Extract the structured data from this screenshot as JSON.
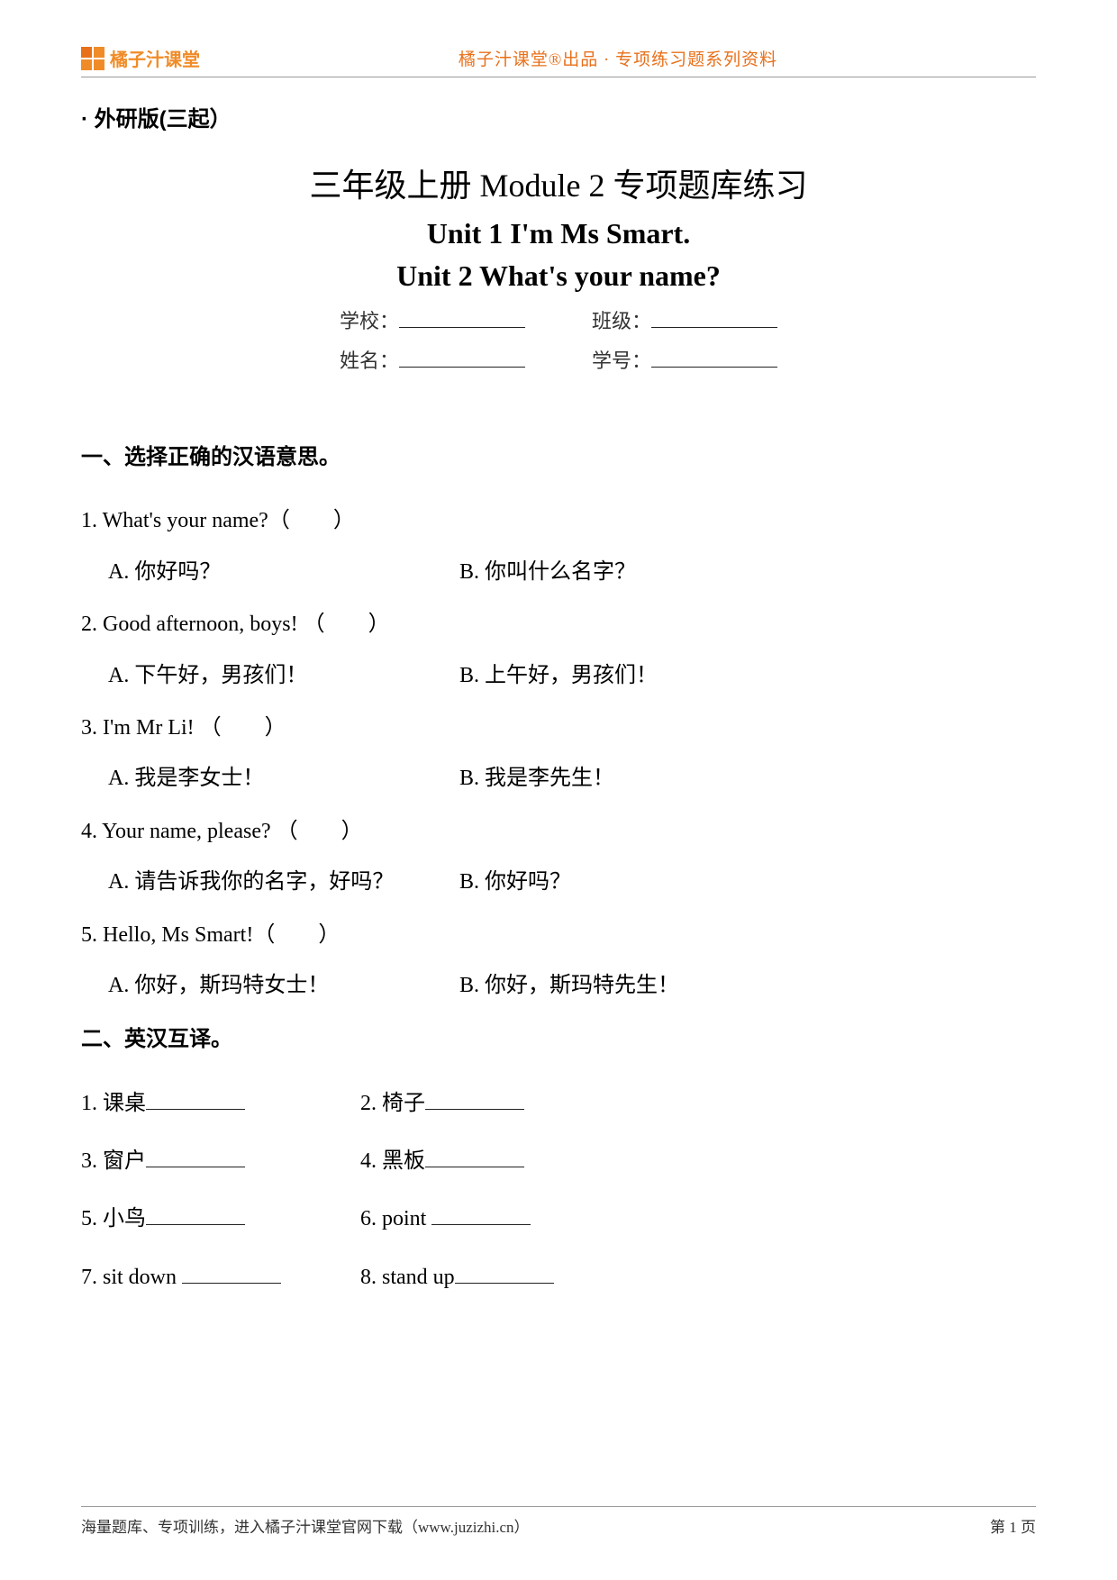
{
  "header": {
    "brand": "橘子汁课堂",
    "center": "橘子汁课堂®出品 · 专项练习题系列资料"
  },
  "edition": "· 外研版(三起）",
  "titles": {
    "line1": "三年级上册 Module 2 专项题库练习",
    "line2": "Unit 1 I'm Ms Smart.",
    "line3": "Unit 2 What's your name?"
  },
  "form": {
    "school_label": "学校：",
    "class_label": "班级：",
    "name_label": "姓名：",
    "id_label": "学号："
  },
  "section1": {
    "title": "一、选择正确的汉语意思。",
    "questions": [
      {
        "q": "1. What's your name?（　　）",
        "a": "A. 你好吗？",
        "b": "B. 你叫什么名字？"
      },
      {
        "q": "2. Good afternoon, boys! （　　）",
        "a": "A. 下午好，男孩们！",
        "b": "B. 上午好，男孩们！"
      },
      {
        "q": "3. I'm Mr Li! （　　）",
        "a": "A. 我是李女士！",
        "b": "B. 我是李先生！"
      },
      {
        "q": "4. Your name, please? （　　）",
        "a": "A. 请告诉我你的名字，好吗？",
        "b": "B. 你好吗？"
      },
      {
        "q": "5. Hello, Ms Smart!（　　）",
        "a": "A. 你好，斯玛特女士！",
        "b": "B. 你好，斯玛特先生！"
      }
    ]
  },
  "section2": {
    "title": "二、英汉互译。",
    "items": [
      "1. 课桌",
      "2. 椅子",
      "3. 窗户",
      "4. 黑板",
      "5. 小鸟",
      "6. point ",
      "7. sit down ",
      "8. stand up"
    ]
  },
  "footer": {
    "left": "海量题库、专项训练，进入橘子汁课堂官网下载（www.juzizhi.cn）",
    "right": "第 1 页"
  }
}
